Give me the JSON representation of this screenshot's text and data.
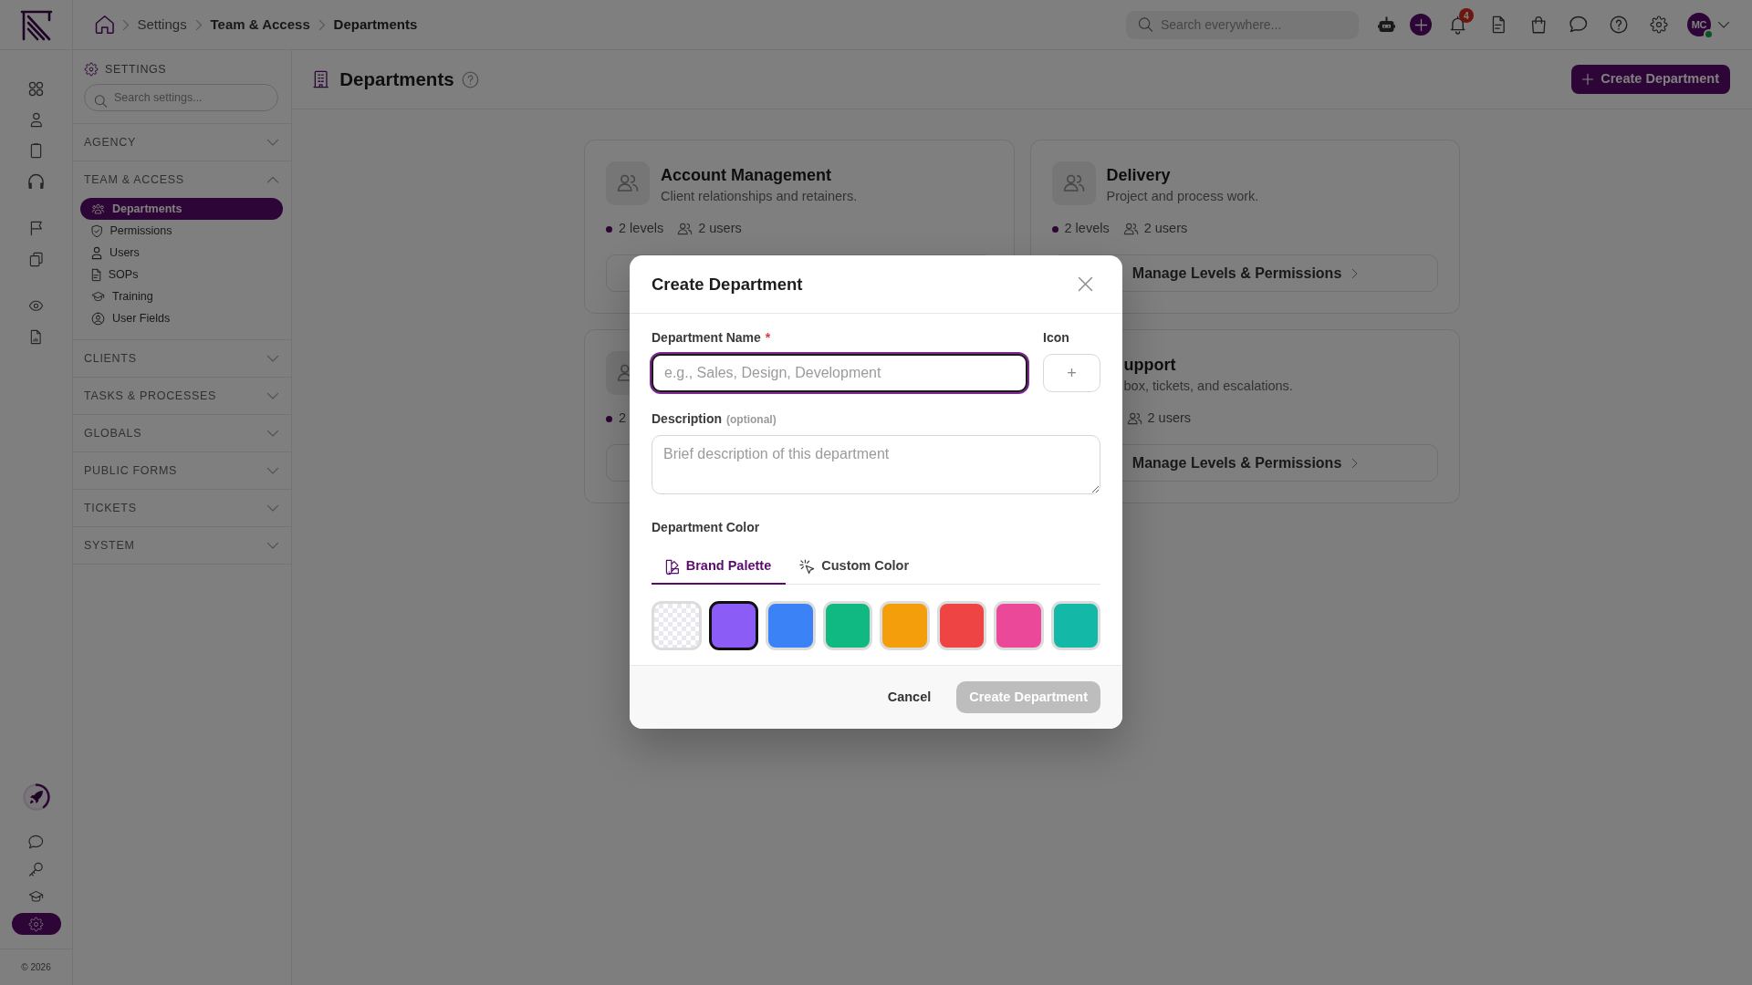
{
  "top_bar": {
    "breadcrumbs": [
      "Settings",
      "Team & Access",
      "Departments"
    ],
    "search": {
      "placeholder": "Search everywhere..."
    },
    "notification_count": "4",
    "avatar": {
      "initials": "MC",
      "online": true
    }
  },
  "rail": {
    "groups": [
      {
        "items": [
          {
            "selected": false
          },
          {
            "selected": false
          },
          {
            "selected": false
          },
          {
            "selected": false
          }
        ]
      },
      {
        "items": [
          {
            "selected": false
          },
          {
            "selected": false
          }
        ]
      },
      {
        "items": [
          {
            "selected": false
          },
          {
            "selected": false
          }
        ]
      }
    ],
    "bottom_items": [
      {
        "selected": false
      },
      {
        "selected": false
      },
      {
        "selected": false
      },
      {
        "selected": true
      }
    ],
    "footer": "© 2026"
  },
  "settings": {
    "title": "SETTINGS",
    "search": {
      "placeholder": "Search settings..."
    },
    "sections": [
      {
        "label": "AGENCY",
        "expanded": false
      },
      {
        "label": "TEAM & ACCESS",
        "expanded": true,
        "items": [
          {
            "label": "Departments",
            "selected": true
          },
          {
            "label": "Permissions",
            "selected": false
          },
          {
            "label": "Users",
            "selected": false
          },
          {
            "label": "SOPs",
            "selected": false
          },
          {
            "label": "Training",
            "selected": false
          },
          {
            "label": "User Fields",
            "selected": false
          }
        ]
      },
      {
        "label": "CLIENTS",
        "expanded": false
      },
      {
        "label": "TASKS & PROCESSES",
        "expanded": false
      },
      {
        "label": "GLOBALS",
        "expanded": false
      },
      {
        "label": "PUBLIC FORMS",
        "expanded": false
      },
      {
        "label": "TICKETS",
        "expanded": false
      },
      {
        "label": "SYSTEM",
        "expanded": false
      }
    ]
  },
  "main": {
    "title": "Departments",
    "create_button": "Create Department",
    "cards": [
      {
        "kind": "full",
        "title": "Account Management",
        "description": "Client relationships and retainers.",
        "levels": "2 levels",
        "users": "2 users"
      },
      {
        "kind": "full",
        "title": "Delivery",
        "description": "Project and process work.",
        "levels": "2 levels",
        "users": "2 users",
        "button": "Manage Levels & Permissions"
      },
      {
        "kind": "left_edge",
        "levels": "2"
      },
      {
        "kind": "right_part",
        "title": "upport",
        "description": "box, tickets, and escalations.",
        "users": "2 users",
        "button": "Manage Levels & Permissions"
      }
    ]
  },
  "modal": {
    "title": "Create Department",
    "name_field": {
      "label": "Department Name",
      "required_mark": "*",
      "placeholder": "e.g., Sales, Design, Development",
      "focused": true
    },
    "icon_field": {
      "label": "Icon",
      "button": "+"
    },
    "description_field": {
      "label": "Description",
      "hint": "(optional)",
      "placeholder": "Brief description of this department"
    },
    "color_label": "Department Color",
    "color_tabs": [
      {
        "label": "Brand Palette",
        "selected": true
      },
      {
        "label": "Custom Color",
        "selected": false
      }
    ],
    "swatches": [
      {
        "kind": "none",
        "selected": false
      },
      {
        "kind": "color",
        "color": "#8b5cf6",
        "selected": true
      },
      {
        "kind": "color",
        "color": "#3b82f6",
        "selected": false
      },
      {
        "kind": "color",
        "color": "#10b981",
        "selected": false
      },
      {
        "kind": "color",
        "color": "#f59e0b",
        "selected": false
      },
      {
        "kind": "color",
        "color": "#ef4444",
        "selected": false
      },
      {
        "kind": "color",
        "color": "#ec4899",
        "selected": false
      },
      {
        "kind": "color",
        "color": "#14b8a6",
        "selected": false
      }
    ],
    "cancel_button": "Cancel",
    "submit_button": {
      "label": "Create Department",
      "disabled": true
    }
  }
}
